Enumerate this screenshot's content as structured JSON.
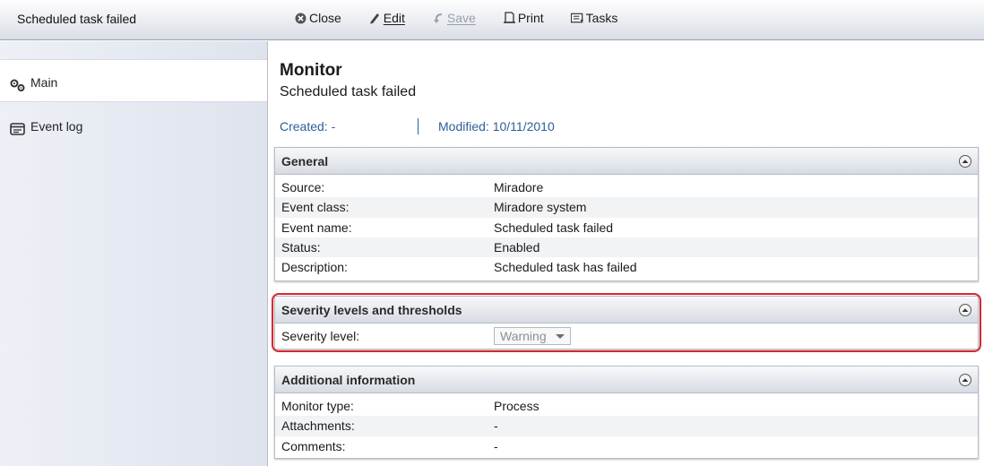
{
  "window": {
    "title": "Scheduled task failed"
  },
  "toolbar": {
    "close": "Close",
    "edit": "Edit",
    "save": "Save",
    "print": "Print",
    "tasks": "Tasks"
  },
  "sidebar": {
    "items": [
      {
        "label": "Main",
        "icon": "gears-icon"
      },
      {
        "label": "Event log",
        "icon": "event-log-icon"
      }
    ]
  },
  "main": {
    "title": "Monitor",
    "subtitle": "Scheduled task failed",
    "created": "Created: -",
    "modified": "Modified: 10/11/2010"
  },
  "general": {
    "title": "General",
    "rows": [
      {
        "key": "Source:",
        "value": "Miradore"
      },
      {
        "key": "Event class:",
        "value": "Miradore system"
      },
      {
        "key": "Event name:",
        "value": "Scheduled task failed"
      },
      {
        "key": "Status:",
        "value": "Enabled"
      },
      {
        "key": "Description:",
        "value": "Scheduled task has failed"
      }
    ]
  },
  "severity": {
    "title": "Severity levels and thresholds",
    "label": "Severity level:",
    "selected": "Warning"
  },
  "additional": {
    "title": "Additional information",
    "rows": [
      {
        "key": "Monitor type:",
        "value": "Process"
      },
      {
        "key": "Attachments:",
        "value": "-"
      },
      {
        "key": "Comments:",
        "value": "-"
      }
    ]
  },
  "colors": {
    "link": "#2c5f98",
    "highlight": "#d9272e",
    "disabled": "#9aa0a8"
  }
}
